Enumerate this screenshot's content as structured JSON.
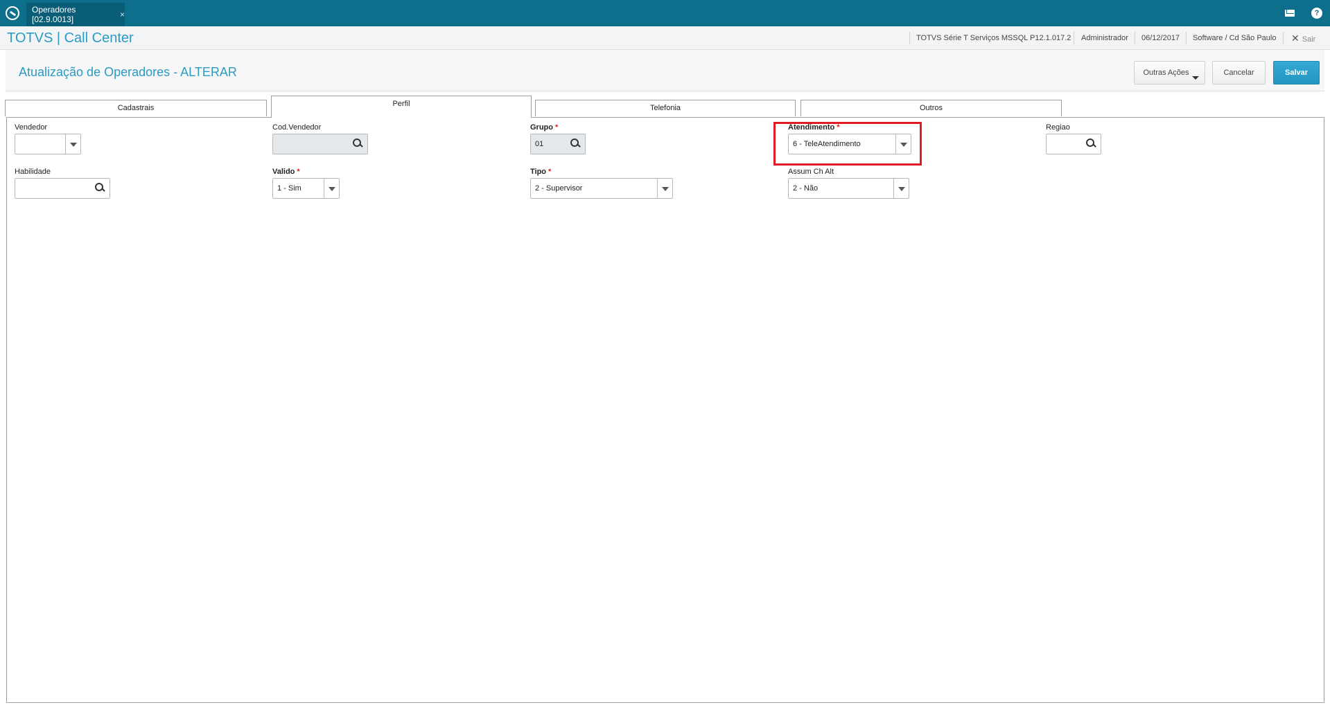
{
  "window": {
    "tab_title": "Operadores [02.9.0013]",
    "tab_close": "×"
  },
  "header": {
    "brand": "TOTVS | Call Center",
    "environment": "TOTVS Série T Serviços MSSQL P12.1.017.2",
    "user": "Administrador",
    "date": "06/12/2017",
    "company": "Software / Cd São Paulo",
    "exit_label": "Sair",
    "help_glyph": "?"
  },
  "page": {
    "title": "Atualização de Operadores - ALTERAR",
    "actions": {
      "other": "Outras Ações",
      "cancel": "Cancelar",
      "save": "Salvar"
    }
  },
  "tabs": [
    {
      "label": "Cadastrais",
      "active": false
    },
    {
      "label": "Perfil",
      "active": true
    },
    {
      "label": "Telefonia",
      "active": false
    },
    {
      "label": "Outros",
      "active": false
    }
  ],
  "form": {
    "vendedor": {
      "label": "Vendedor",
      "value": "",
      "control": "dropdown"
    },
    "cod_vendedor": {
      "label": "Cod.Vendedor",
      "value": "",
      "control": "search",
      "disabled": true
    },
    "grupo": {
      "label": "Grupo",
      "value": "01",
      "required": true,
      "control": "search"
    },
    "atendimento": {
      "label": "Atendimento",
      "value": "6 - TeleAtendimento",
      "required": true,
      "control": "dropdown",
      "highlighted": true
    },
    "regiao": {
      "label": "Regiao",
      "value": "",
      "control": "search"
    },
    "habilidade": {
      "label": "Habilidade",
      "value": "",
      "control": "search"
    },
    "valido": {
      "label": "Valido",
      "value": "1 - Sim",
      "required": true,
      "control": "dropdown"
    },
    "tipo": {
      "label": "Tipo",
      "value": "2 - Supervisor",
      "required": true,
      "control": "dropdown"
    },
    "assum_ch_alt": {
      "label": "Assum Ch Alt",
      "value": "2 - Não",
      "control": "dropdown"
    }
  },
  "colors": {
    "topbar": "#0e6f8c",
    "accent": "#2a9bc3",
    "primary_button": "#2395c1",
    "required_star": "#e02020",
    "highlight": "#e01b24"
  }
}
